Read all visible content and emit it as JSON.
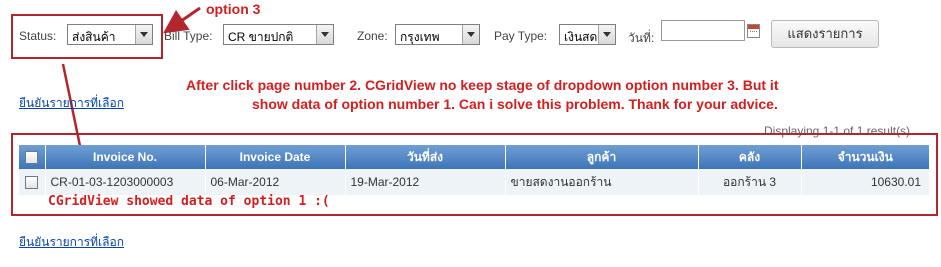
{
  "filters": {
    "status_label": "Status:",
    "status_value": "ส่งสินค้า",
    "bill_type_label": "Bill Type:",
    "bill_type_value": "CR ขายปกติ",
    "zone_label": "Zone:",
    "zone_value": "กรุงเทพ",
    "pay_type_label": "Pay Type:",
    "pay_type_value": "เงินสด",
    "date_label": "วันที่:",
    "date_value": "",
    "show_button": "แสดงรายการ"
  },
  "annotations": {
    "option_label": "option 3",
    "question_line1": "After click page number 2. CGridView no keep stage of dropdown option number 3. But it",
    "question_line2": "show data of option number 1. Can i solve this problem. Thank for your advice.",
    "grid_note": "CGridView showed data of option 1 :("
  },
  "confirm_link": "ยืนยันรายการที่เลือก",
  "grid": {
    "summary": "Displaying 1-1 of 1 result(s).",
    "columns": [
      "Invoice No.",
      "Invoice Date",
      "วันที่ส่ง",
      "ลูกค้า",
      "คลัง",
      "จำนวนเงิน"
    ],
    "rows": [
      {
        "invoice_no": "CR-01-03-1203000003",
        "invoice_date": "06-Mar-2012",
        "delivery_date": "19-Mar-2012",
        "customer": "ขายสดงานออกร้าน",
        "warehouse": "ออกร้าน 3",
        "amount": "10630.01"
      }
    ]
  },
  "colors": {
    "annotation_red": "#d21f1f",
    "header_blue": "#4f86c6",
    "link_blue": "#0645ad"
  }
}
